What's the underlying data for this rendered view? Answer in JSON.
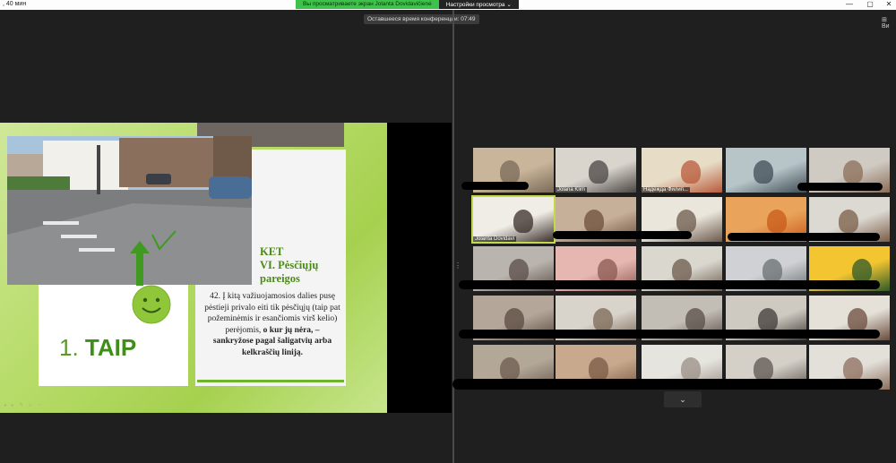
{
  "topbar": {
    "time_left": ", 40 мин",
    "share_status": "Вы просматриваете экран Jolanta Dovidavičienė",
    "view_options": "Настройки просмотра ⌄",
    "window_controls": [
      "—",
      "▢",
      "✕"
    ]
  },
  "meeting": {
    "timer_label": "Оставшееся время конференции: 07:49",
    "view_button": "Ви"
  },
  "slide": {
    "heading_line1": "KET",
    "heading_line2": "VI. Pėsčiųjų",
    "heading_line3": "pareigos",
    "rule_intro": "42. Į kitą važiuojamosios dalies pusę pėstieji privalo eiti tik pėsčiųjų (taip pat požeminėmis ir esančiomis virš kelio) perėjomis,",
    "rule_bold": "o kur jų nėra, – sankryžose pagal šaligatvių arba kelkraščių liniją.",
    "answer_number": "1.",
    "answer_word": "TAIP",
    "tools": "◂ ▸ ✎ ⌕ ⋯",
    "icons": [
      "arrow-up-icon",
      "smiley-icon",
      "checkmark-icon"
    ]
  },
  "participants": [
    {
      "name": ""
    },
    {
      "name": "Jolana Klim"
    },
    {
      "name": "Надежда Филип..."
    },
    {
      "name": ""
    },
    {
      "name": ""
    },
    {
      "name": "Jolanta Dovidavi"
    },
    {
      "name": ""
    },
    {
      "name": ""
    },
    {
      "name": ""
    },
    {
      "name": ""
    },
    {
      "name": ""
    },
    {
      "name": ""
    },
    {
      "name": ""
    },
    {
      "name": ""
    },
    {
      "name": ""
    },
    {
      "name": ""
    },
    {
      "name": ""
    },
    {
      "name": ""
    },
    {
      "name": ""
    },
    {
      "name": ""
    },
    {
      "name": ""
    },
    {
      "name": ""
    },
    {
      "name": ""
    },
    {
      "name": ""
    },
    {
      "name": ""
    }
  ],
  "grid": {
    "scroll_down": "⌄",
    "side_handle": "⋮"
  },
  "colors": {
    "slide_green": "#a6d14f",
    "heading_green": "#4c8a17",
    "share_green": "#3ec34a",
    "active_speaker": "#c3d84a"
  }
}
